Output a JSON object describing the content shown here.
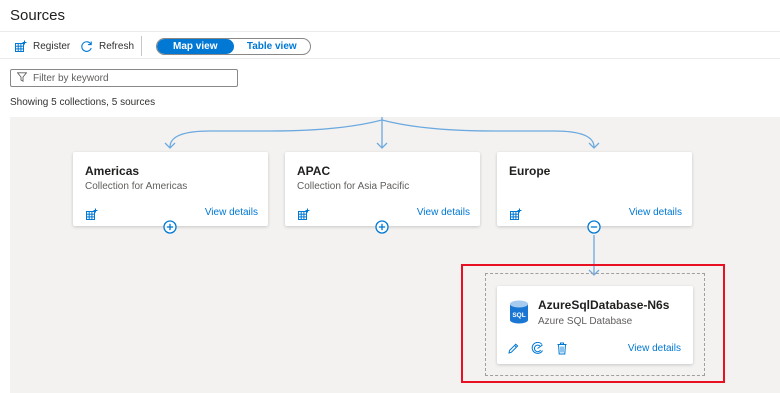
{
  "page": {
    "title": "Sources"
  },
  "toolbar": {
    "register_label": "Register",
    "refresh_label": "Refresh",
    "view_toggle": {
      "map_label": "Map view",
      "table_label": "Table view",
      "selected": "Map view"
    }
  },
  "filter": {
    "placeholder": "Filter by keyword",
    "value": ""
  },
  "summary": "Showing 5 collections, 5 sources",
  "collections": [
    {
      "name": "Americas",
      "description": "Collection for Americas",
      "details_label": "View details",
      "state": "collapsed"
    },
    {
      "name": "APAC",
      "description": "Collection for Asia Pacific",
      "details_label": "View details",
      "state": "collapsed"
    },
    {
      "name": "Europe",
      "description": "",
      "details_label": "View details",
      "state": "expanded"
    }
  ],
  "source": {
    "name": "AzureSqlDatabase-N6s",
    "type": "Azure SQL Database",
    "icon_text": "SQL",
    "details_label": "View details",
    "actions": [
      "edit-icon",
      "scan-icon",
      "delete-icon"
    ]
  },
  "colors": {
    "accent": "#0078d4",
    "connector": "#6ca9df",
    "highlight": "#e81123",
    "canvas": "#f3f2f1"
  }
}
